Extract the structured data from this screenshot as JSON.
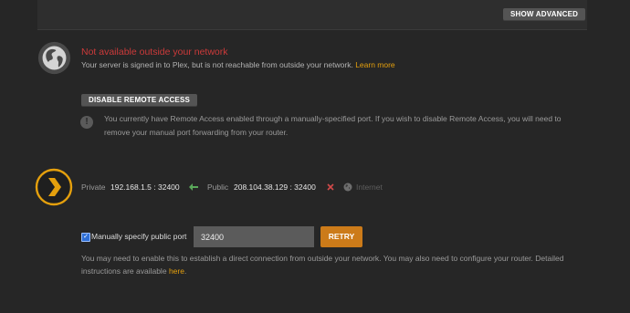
{
  "advanced": {
    "show_advanced_label": "SHOW ADVANCED"
  },
  "status": {
    "title": "Not available outside your network",
    "description": "Your server is signed in to Plex, but is not reachable from outside your network.",
    "learn_more": "Learn more",
    "title_color": "#cc3a3a"
  },
  "remote_access": {
    "disable_label": "DISABLE REMOTE ACCESS",
    "warning_text": "You currently have Remote Access enabled through a manually-specified port. If you wish to disable Remote Access, you will need to remove your manual port forwarding from your router."
  },
  "connection": {
    "private_label": "Private",
    "private_address": "192.168.1.5 : 32400",
    "arrow_icon": "left-arrow-icon",
    "public_label": "Public",
    "public_address": "208.104.38.129 : 32400",
    "status_icon": "x-icon",
    "internet_icon": "globe-icon",
    "internet_label": "Internet"
  },
  "manual_port": {
    "checked": true,
    "checkbox_label": "Manually specify public port",
    "port_value": "32400",
    "retry_label": "RETRY",
    "help_text": "You may need to enable this to establish a direct connection from outside your network. You may also need to configure your router. Detailed instructions are available",
    "here_link": "here",
    "accent_color": "#e5a00d"
  }
}
